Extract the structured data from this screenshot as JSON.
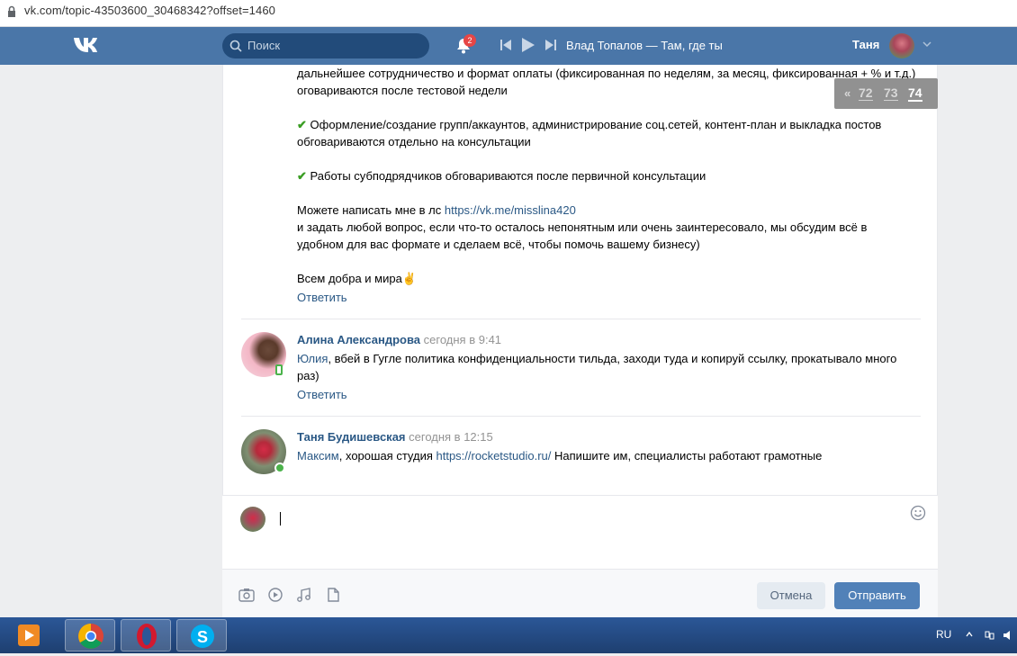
{
  "browser": {
    "url": "vk.com/topic-43503600_30468342?offset=1460"
  },
  "header": {
    "search_placeholder": "Поиск",
    "notifications_count": "2",
    "track": "Влад Топалов — Там, где ты",
    "user_name": "Таня"
  },
  "pager": {
    "prev": "«",
    "pages": [
      "72",
      "73",
      "74"
    ],
    "current": "74"
  },
  "post": {
    "lines": [
      "дальнейшее сотрудничество и формат оплаты (фиксированная по неделям, за месяц, фиксированная + % и т.д.)",
      "оговариваются после тестовой недели",
      "Оформление/создание групп/аккаунтов, администрирование соц.сетей, контент-план и выкладка постов",
      "обговариваются отдельно на консультации",
      "Работы субподрядчиков обговариваются после первичной консультации",
      "Можете написать мне в лс ",
      "https://vk.me/misslina420",
      "и задать любой вопрос, если что-то осталось непонятным или очень заинтересовало, мы обсудим всё в",
      "удобном для вас формате и сделаем всё, чтобы помочь вашему бизнесу)",
      "Всем добра и мира"
    ],
    "check_glyph": "✔",
    "peace_glyph": "✌",
    "reply_label": "Ответить"
  },
  "comments": [
    {
      "author": "Алина Александрова",
      "time": "сегодня в 9:41",
      "mention": "Юлия",
      "text_1": ", вбей в Гугле политика конфиденциальности тильда, заходи туда и копируй ссылку, прокатывало много",
      "text_2": "раз)",
      "reply_label": "Ответить"
    },
    {
      "author": "Таня Будишевская",
      "time": "сегодня в 12:15",
      "mention": "Максим",
      "text_1": ", хорошая студия ",
      "link": "https://rocketstudio.ru/",
      "text_2": " Напишите им, специалисты работают грамотные"
    }
  ],
  "composer": {
    "cancel_label": "Отмена",
    "send_label": "Отправить"
  },
  "taskbar": {
    "lang": "RU"
  },
  "colors": {
    "vk_blue": "#4a76a8",
    "link": "#2a5885",
    "send": "#5181b8",
    "online": "#4bb34b"
  },
  "icons": [
    "lock-icon",
    "vk-logo-icon",
    "search-icon",
    "bell-icon",
    "prev-track-icon",
    "play-icon",
    "next-track-icon",
    "chevron-down-icon",
    "smile-icon",
    "camera-icon",
    "video-icon",
    "music-icon",
    "document-icon"
  ]
}
